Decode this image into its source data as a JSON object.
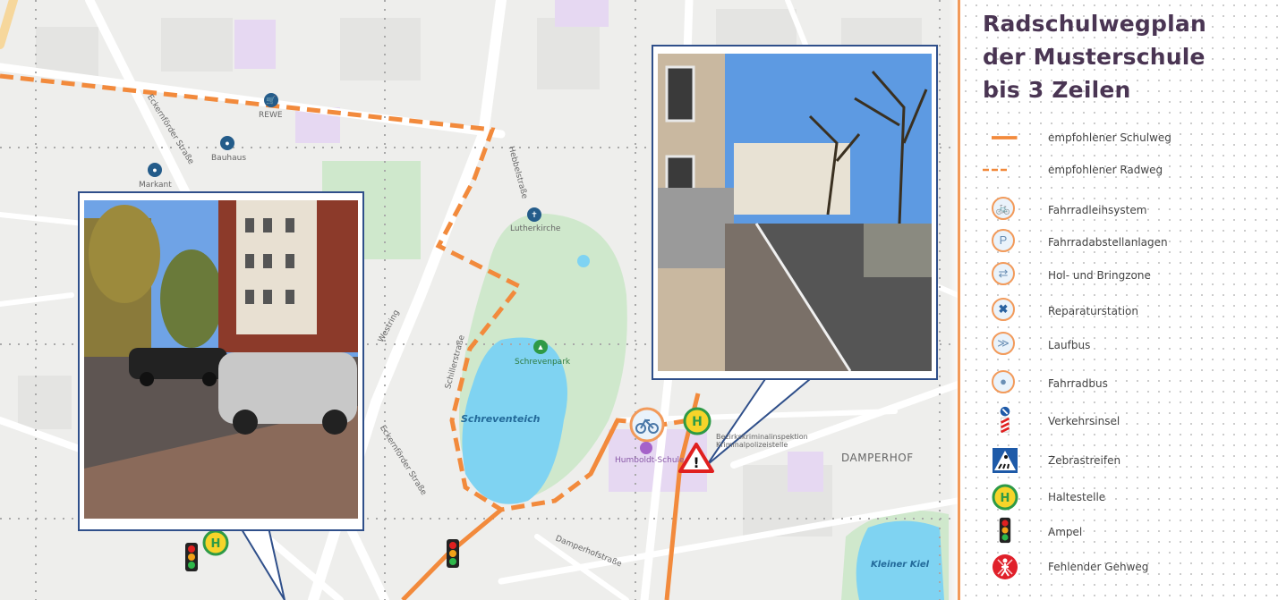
{
  "legend": {
    "title_lines": [
      "Radschulwegplan",
      "der Musterschule",
      "bis 3 Zeilen"
    ],
    "items": [
      {
        "label": "empfohlener Schulweg",
        "symbol": "solid-orange-line-icon"
      },
      {
        "label": "empfohlener Radweg",
        "symbol": "dashed-orange-line-icon"
      },
      {
        "label": "Fahrradleihsystem",
        "symbol": "bike-rental-icon"
      },
      {
        "label": "Fahrradabstellanlagen",
        "symbol": "bike-parking-icon"
      },
      {
        "label": "Hol- und Bringzone",
        "symbol": "drop-off-zone-icon"
      },
      {
        "label": "Reparaturstation",
        "symbol": "repair-station-icon"
      },
      {
        "label": "Laufbus",
        "symbol": "walking-bus-icon"
      },
      {
        "label": "Fahrradbus",
        "symbol": "bike-bus-icon"
      },
      {
        "label": "Verkehrsinsel",
        "symbol": "traffic-island-icon"
      },
      {
        "label": "Zebrastreifen",
        "symbol": "crosswalk-icon"
      },
      {
        "label": "Haltestelle",
        "symbol": "bus-stop-icon"
      },
      {
        "label": "Ampel",
        "symbol": "traffic-light-icon"
      },
      {
        "label": "Fehlender Gehweg",
        "symbol": "missing-sidewalk-icon"
      }
    ]
  },
  "map": {
    "labels": {
      "rewe": "REWE",
      "bauhaus": "Bauhaus",
      "markant": "Markant",
      "lutherkirche": "Lutherkirche",
      "schrevenpark": "Schrevenpark",
      "schreventeich": "Schreventeich",
      "humboldt": "Humboldt-Schule",
      "damperhof": "DAMPERHOF",
      "kleiner_kiel": "Kleiner Kiel",
      "westring": "Westring",
      "eckernfoerder": "Eckernförder Straße",
      "eckernfoerder2": "Eckernförder Straße",
      "schillerstrasse": "Schillerstraße",
      "damperhofstrasse": "Damperhofstraße",
      "hebbelstrasse": "Hebbelstraße",
      "polizei": "Bezirkskriminalinspektion Kriminalpolizeistelle"
    }
  },
  "colors": {
    "route": "#f28a3c",
    "water": "#7fd3f2",
    "park": "#cde8c9",
    "frame": "#2f4f8a",
    "title": "#4a3553"
  }
}
